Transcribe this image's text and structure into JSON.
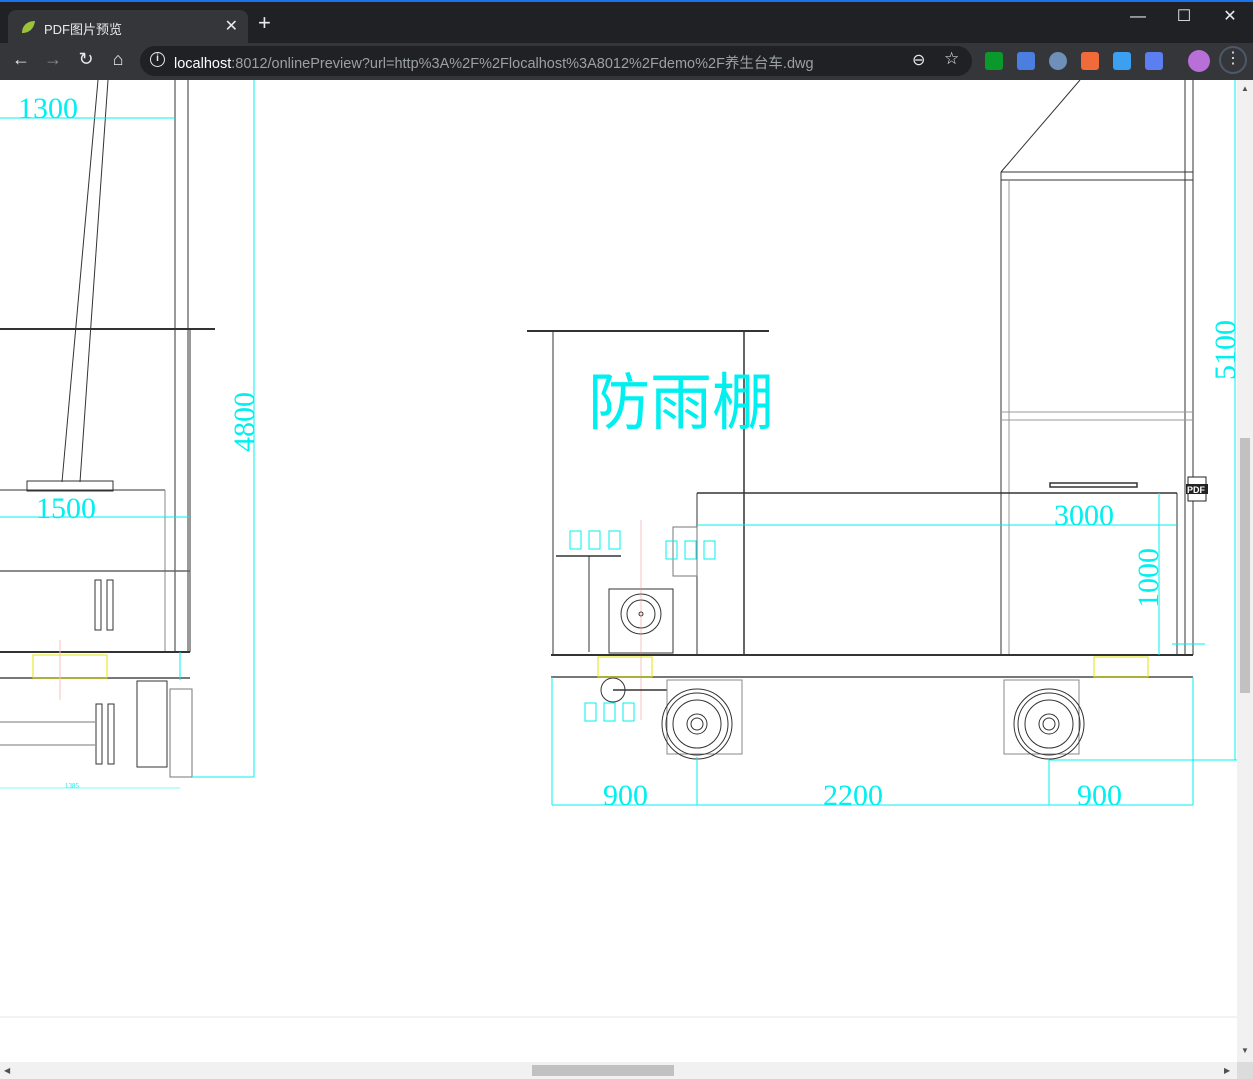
{
  "browser": {
    "tab_title": "PDF图片预览",
    "url_host": "localhost",
    "url_rest": ":8012/onlinePreview?url=http%3A%2F%2Flocalhost%3A8012%2Fdemo%2F养生台车.dwg",
    "extensions": [
      "tampermonkey-icon",
      "google-translate-icon",
      "circle-extension-icon",
      "orange-extension-icon",
      "cloud-extension-icon",
      "swift-extension-icon"
    ]
  },
  "drawing": {
    "dims_left": {
      "d1300": "1300",
      "d4800": "4800",
      "d1500": "1500",
      "d1385": "1385"
    },
    "dims_right": {
      "d5100": "5100",
      "d3000": "3000",
      "d1000": "1000",
      "d900a": "900",
      "d2200": "2200",
      "d900b": "900"
    },
    "label_rain_shelter": "防雨棚",
    "pdf_badge": "PDF"
  },
  "colors": {
    "dimension": "#00f0f0",
    "accent": "#1a73e8"
  }
}
